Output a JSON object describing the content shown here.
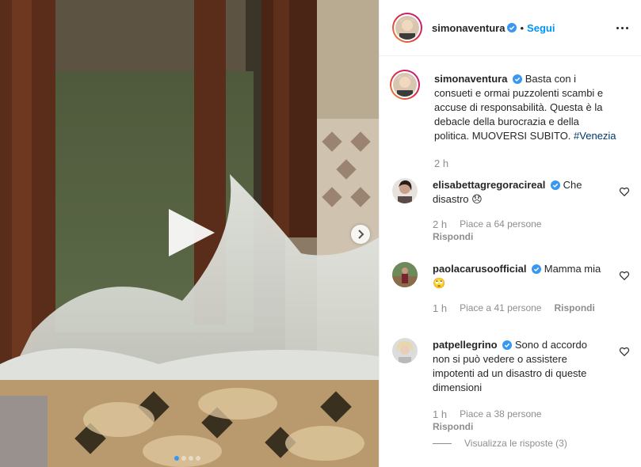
{
  "header": {
    "username": "simonaventura",
    "separator": "•",
    "follow_label": "Segui"
  },
  "caption": {
    "username": "simonaventura",
    "text": "Basta con i consueti e ormai puzzolenti scambi e accuse di responsabilità. Questa è la debacle della burocrazia e della politica. MUOVERSI SUBITO.",
    "hashtag": "#Venezia",
    "time": "2 h"
  },
  "comments": [
    {
      "username": "elisabettagregoracireal",
      "text": "Che disastro 😞",
      "time": "2 h",
      "likes": "Piace a 64 persone",
      "reply": "Rispondi"
    },
    {
      "username": "paolacarusoofficial",
      "text": "Mamma mia 🙄",
      "time": "1 h",
      "likes": "Piace a 41 persone",
      "reply": "Rispondi"
    },
    {
      "username": "patpellegrino",
      "text": "Sono d accordo non si può vedere o assistere impotenti ad un disastro di queste dimensioni",
      "time": "1 h",
      "likes": "Piace a 38 persone",
      "reply": "Rispondi"
    }
  ],
  "view_replies": "Visualizza le risposte (3)",
  "carousel": {
    "total": 4,
    "active": 0
  },
  "colors": {
    "accent": "#0095f6",
    "verified": "#3897f0",
    "muted": "#8e8e8e"
  },
  "icons": {
    "play": "play-icon",
    "next": "chevron-right-icon",
    "like": "heart-icon",
    "more": "more-options-icon",
    "verified": "verified-badge-icon"
  }
}
